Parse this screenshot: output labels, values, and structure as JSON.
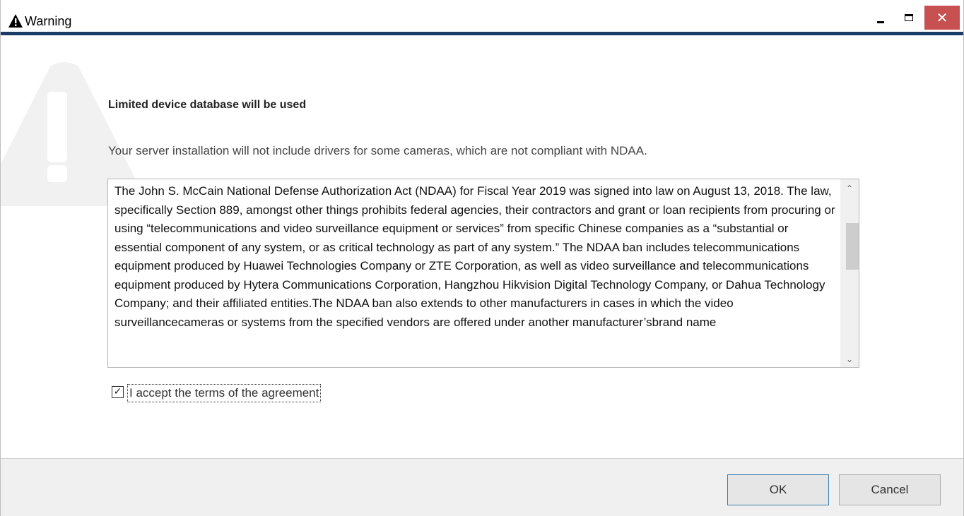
{
  "window": {
    "title": "Warning",
    "close_label": "✕"
  },
  "content": {
    "heading": "Limited device database will be used",
    "subtext": "Your server installation will not include drivers for some cameras, which are not compliant with NDAA.",
    "agreement_text": "The John S. McCain National Defense Authorization Act (NDAA) for Fiscal Year 2019 was signed into law on August 13, 2018. The law, specifically Section 889, amongst other things prohibits federal agencies, their contractors and grant or loan recipients from procuring or using “telecommunications and video surveillance equipment or services” from specific Chinese companies as a “substantial or essential component of any system, or as critical technology as part of any system.” The NDAA ban includes telecommunications equipment produced by Huawei Technologies Company or ZTE Corporation, as well as video surveillance and telecommunications equipment produced by Hytera Communications Corporation, Hangzhou Hikvision Digital Technology Company, or Dahua Technology Company; and their affiliated entities.The NDAA ban also extends to other manufacturers in cases in which the video surveillancecameras or systems from the specified vendors are offered under another manufacturer’sbrand name",
    "accept_checked": true,
    "accept_label": "I accept the terms of the agreement"
  },
  "footer": {
    "ok_label": "OK",
    "cancel_label": "Cancel"
  },
  "icons": {
    "title": "warning-icon",
    "background": "warning-background-icon",
    "minimize": "minimize-icon",
    "maximize": "maximize-icon",
    "close": "close-icon",
    "check": "checkmark-icon"
  },
  "colors": {
    "titlebar_accent": "#1a3b66",
    "close_button": "#c75050",
    "ok_border": "#3c7fb1"
  }
}
